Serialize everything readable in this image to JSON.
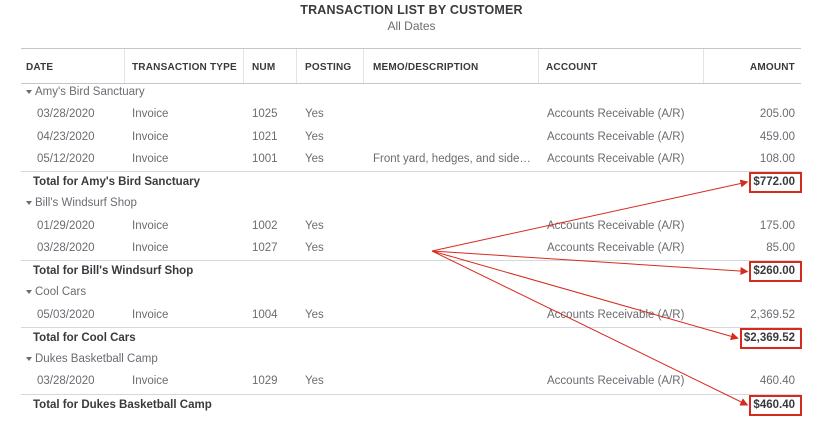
{
  "report": {
    "title": "TRANSACTION LIST BY CUSTOMER",
    "subtitle": "All Dates"
  },
  "columns": {
    "date": "DATE",
    "transaction_type": "TRANSACTION TYPE",
    "num": "NUM",
    "posting": "POSTING",
    "memo": "MEMO/DESCRIPTION",
    "account": "ACCOUNT",
    "amount": "AMOUNT"
  },
  "groups": [
    {
      "name": "Amy's Bird Sanctuary",
      "rows": [
        {
          "date": "03/28/2020",
          "type": "Invoice",
          "num": "1025",
          "posting": "Yes",
          "memo": "",
          "account": "Accounts Receivable (A/R)",
          "amount": "205.00"
        },
        {
          "date": "04/23/2020",
          "type": "Invoice",
          "num": "1021",
          "posting": "Yes",
          "memo": "",
          "account": "Accounts Receivable (A/R)",
          "amount": "459.00"
        },
        {
          "date": "05/12/2020",
          "type": "Invoice",
          "num": "1001",
          "posting": "Yes",
          "memo": "Front yard, hedges, and side…",
          "account": "Accounts Receivable (A/R)",
          "amount": "108.00"
        }
      ],
      "total_label": "Total for Amy's Bird Sanctuary",
      "total": "$772.00"
    },
    {
      "name": "Bill's Windsurf Shop",
      "rows": [
        {
          "date": "01/29/2020",
          "type": "Invoice",
          "num": "1002",
          "posting": "Yes",
          "memo": "",
          "account": "Accounts Receivable (A/R)",
          "amount": "175.00"
        },
        {
          "date": "03/28/2020",
          "type": "Invoice",
          "num": "1027",
          "posting": "Yes",
          "memo": "",
          "account": "Accounts Receivable (A/R)",
          "amount": "85.00"
        }
      ],
      "total_label": "Total for Bill's Windsurf Shop",
      "total": "$260.00"
    },
    {
      "name": "Cool Cars",
      "rows": [
        {
          "date": "05/03/2020",
          "type": "Invoice",
          "num": "1004",
          "posting": "Yes",
          "memo": "",
          "account": "Accounts Receivable (A/R)",
          "amount": "2,369.52"
        }
      ],
      "total_label": "Total for Cool Cars",
      "total": "$2,369.52"
    },
    {
      "name": "Dukes Basketball Camp",
      "rows": [
        {
          "date": "03/28/2020",
          "type": "Invoice",
          "num": "1029",
          "posting": "Yes",
          "memo": "",
          "account": "Accounts Receivable (A/R)",
          "amount": "460.40"
        }
      ],
      "total_label": "Total for Dukes Basketball Camp",
      "total": "$460.40"
    }
  ],
  "annotation": {
    "color": "#d52b1e"
  }
}
